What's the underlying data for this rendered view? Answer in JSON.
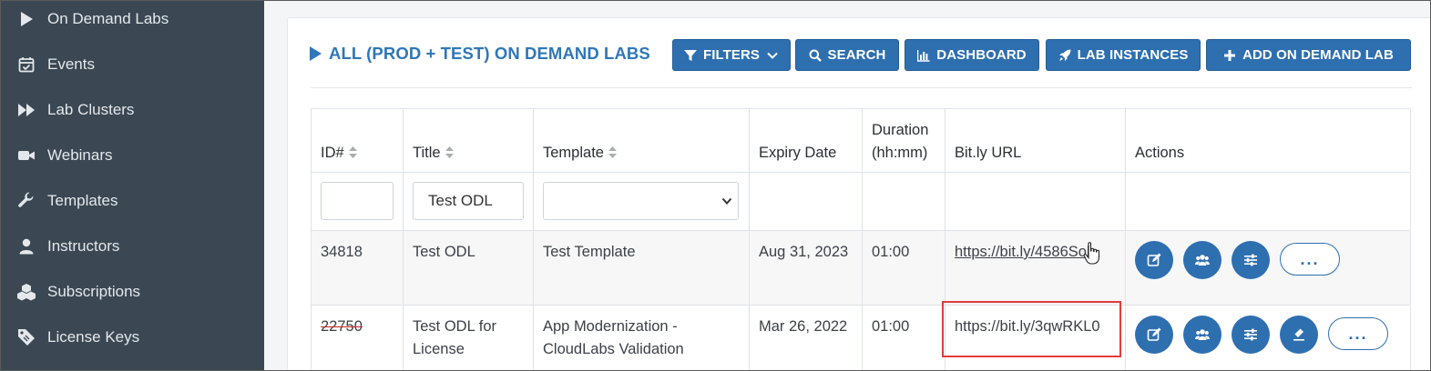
{
  "sidebar": {
    "items": [
      {
        "label": "On Demand Labs",
        "icon": "play-icon"
      },
      {
        "label": "Events",
        "icon": "calendar-check-icon"
      },
      {
        "label": "Lab Clusters",
        "icon": "fast-forward-icon"
      },
      {
        "label": "Webinars",
        "icon": "video-camera-icon"
      },
      {
        "label": "Templates",
        "icon": "wrench-icon"
      },
      {
        "label": "Instructors",
        "icon": "user-icon"
      },
      {
        "label": "Subscriptions",
        "icon": "cubes-icon"
      },
      {
        "label": "License Keys",
        "icon": "ticket-icon"
      }
    ]
  },
  "page": {
    "title": "ALL (PROD + TEST) ON DEMAND LABS"
  },
  "toolbar": {
    "filters": "FILTERS",
    "search": "SEARCH",
    "dashboard": "DASHBOARD",
    "lab_instances": "LAB INSTANCES",
    "add": "ADD ON DEMAND LAB"
  },
  "table": {
    "headers": {
      "id": "ID#",
      "title": "Title",
      "template": "Template",
      "expiry": "Expiry Date",
      "duration_1": "Duration",
      "duration_2": "(hh:mm)",
      "url": "Bit.ly URL",
      "actions": "Actions"
    },
    "filters": {
      "id": "",
      "title": "Test ODL",
      "template": ""
    },
    "rows": [
      {
        "id": "34818",
        "title_1": "Test ODL",
        "title_2": "",
        "template_1": "Test Template",
        "template_2": "",
        "expiry": "Aug 31, 2023",
        "duration": "01:00",
        "url": "https://bit.ly/4586Sol",
        "more": "..."
      },
      {
        "id": "22750",
        "title_1": "Test ODL for",
        "title_2": "License",
        "template_1": "App Modernization -",
        "template_2": "CloudLabs Validation",
        "expiry": "Mar 26, 2022",
        "duration": "01:00",
        "url": "https://bit.ly/3qwRKL0",
        "more": "..."
      }
    ]
  },
  "colors": {
    "sidebar_bg": "#3b4752",
    "accent": "#2e6fb0",
    "title": "#2f77b8",
    "highlight": "#e23b3b"
  }
}
